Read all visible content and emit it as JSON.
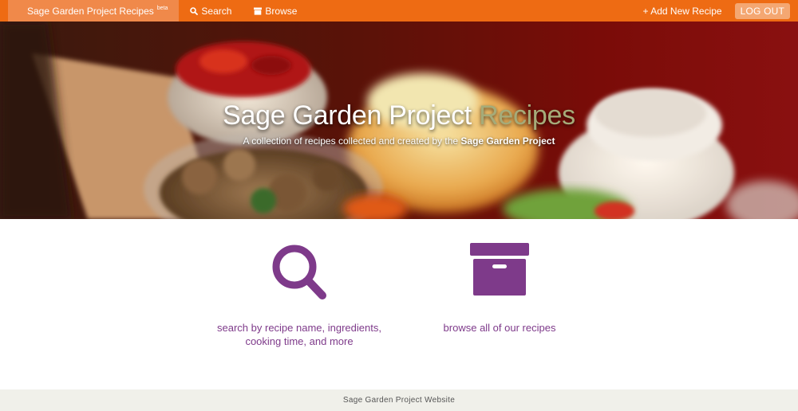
{
  "navbar": {
    "brand": "Sage Garden Project Recipes",
    "brand_badge": "beta",
    "search_label": "Search",
    "browse_label": "Browse",
    "add_label": "+ Add New Recipe",
    "logout_label": "LOG OUT",
    "color": "#ee6b13"
  },
  "hero": {
    "title_main": "Sage Garden Project",
    "title_accent": "Recipes",
    "subtitle_prefix": "A collection of recipes collected and created by the",
    "subtitle_strong": "Sage Garden Project"
  },
  "features": {
    "search": {
      "icon": "search-icon",
      "line1": "search by recipe name, ingredients,",
      "line2": "cooking time, and more"
    },
    "browse": {
      "icon": "archive-box-icon",
      "label": "browse all of our recipes"
    },
    "color": "#7e3a8a"
  },
  "footer": {
    "text": "Sage Garden Project Website"
  }
}
